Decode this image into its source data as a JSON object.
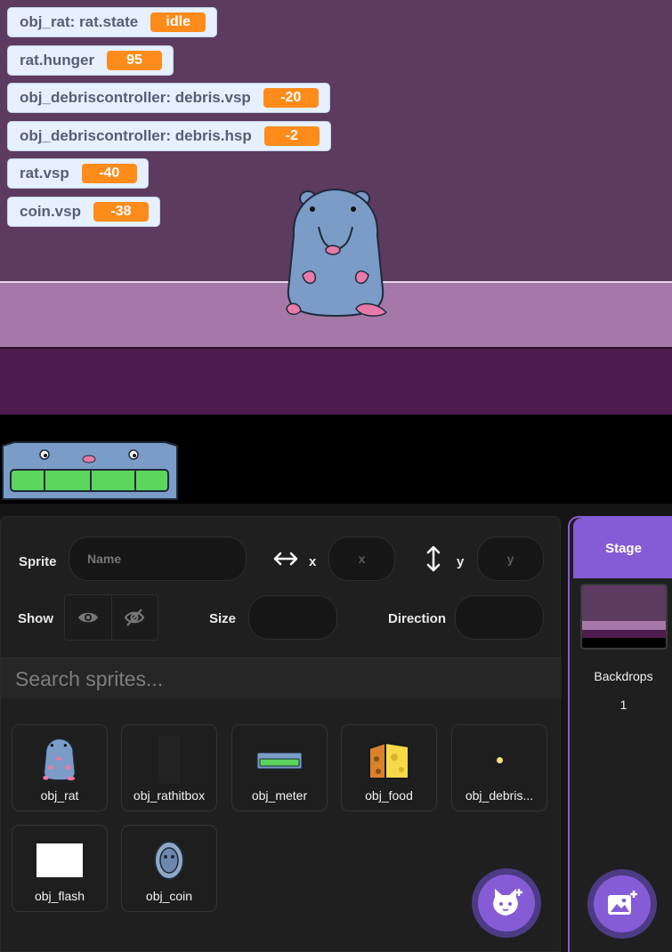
{
  "stage": {
    "monitors": [
      {
        "label": "obj_rat: rat.state",
        "value": "idle"
      },
      {
        "label": "rat.hunger",
        "value": "95"
      },
      {
        "label": "obj_debriscontroller: debris.vsp",
        "value": "-20"
      },
      {
        "label": "obj_debriscontroller: debris.hsp",
        "value": "-2"
      },
      {
        "label": "rat.vsp",
        "value": "-40"
      },
      {
        "label": "coin.vsp",
        "value": "-38"
      }
    ]
  },
  "sprite_info": {
    "sprite_label": "Sprite",
    "name_placeholder": "Name",
    "x_icon": "horizontal-arrows-icon",
    "x_label": "x",
    "x_placeholder": "x",
    "y_icon": "vertical-arrows-icon",
    "y_label": "y",
    "y_placeholder": "y",
    "show_label": "Show",
    "show_icon": "eye-icon",
    "hide_icon": "eye-slash-icon",
    "size_label": "Size",
    "direction_label": "Direction"
  },
  "search": {
    "placeholder": "Search sprites..."
  },
  "sprites": [
    {
      "name": "obj_rat",
      "icon": "rat-thumbnail"
    },
    {
      "name": "obj_rathitbox",
      "icon": "hitbox-thumbnail"
    },
    {
      "name": "obj_meter",
      "icon": "meter-thumbnail"
    },
    {
      "name": "obj_food",
      "icon": "cheese-thumbnail"
    },
    {
      "name": "obj_debris...",
      "icon": "debris-thumbnail"
    },
    {
      "name": "obj_flash",
      "icon": "flash-thumbnail"
    },
    {
      "name": "obj_coin",
      "icon": "coin-thumbnail"
    }
  ],
  "buttons": {
    "add_sprite_icon": "cat-plus-icon",
    "add_backdrop_icon": "image-plus-icon"
  },
  "stage_panel": {
    "title": "Stage",
    "backdrops_label": "Backdrops",
    "backdrops_count": "1"
  },
  "colors": {
    "accent": "#855cd6",
    "monitor_value": "#ff8c1a",
    "wall": "#5d3a5f",
    "floor": "#a678a7"
  }
}
